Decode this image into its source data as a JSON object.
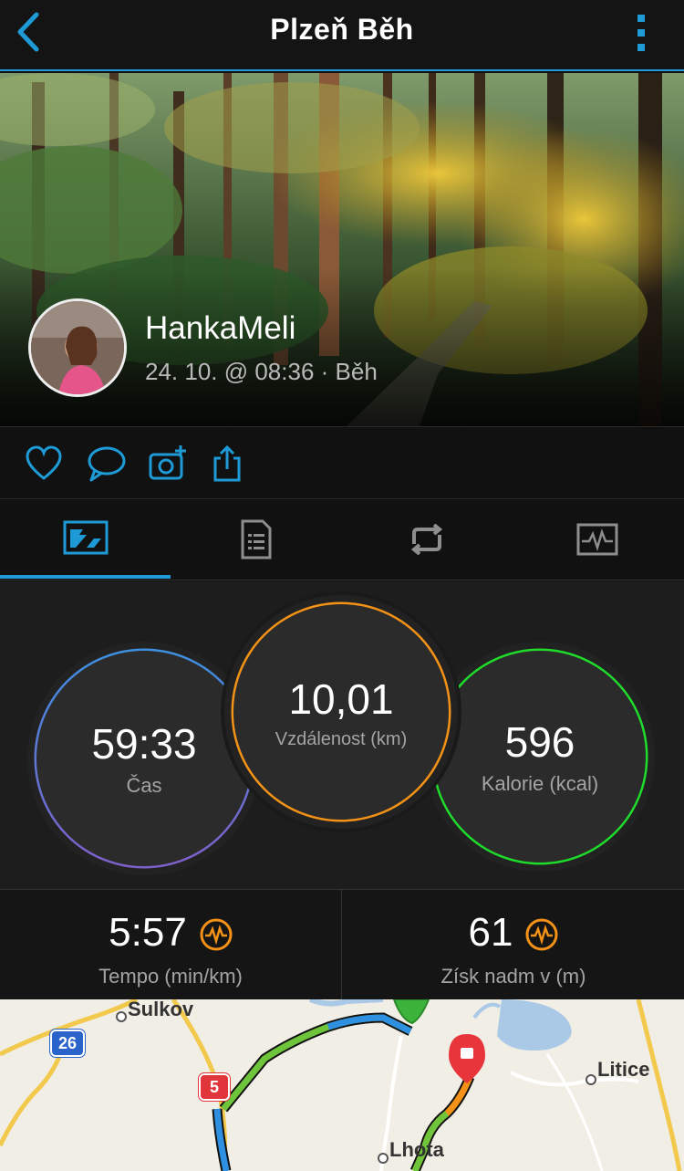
{
  "header": {
    "title": "Plzeň Běh",
    "back_icon": "chevron-left-icon",
    "menu_icon": "more-vertical-icon"
  },
  "profile": {
    "name": "HankaMeli",
    "subtitle": "24. 10. @ 08:36 · Běh"
  },
  "actions": [
    "heart-icon",
    "comment-icon",
    "add-photo-icon",
    "share-icon"
  ],
  "tabs": [
    "overview-icon",
    "details-icon",
    "laps-icon",
    "charts-icon"
  ],
  "stats": {
    "time": {
      "value": "59:33",
      "label": "Čas"
    },
    "distance": {
      "value": "10,01",
      "label": "Vzdálenost (km)"
    },
    "calories": {
      "value": "596",
      "label": "Kalorie (kcal)"
    }
  },
  "metrics": {
    "pace": {
      "value": "5:57",
      "label": "Tempo (min/km)"
    },
    "elevation": {
      "value": "61",
      "label": "Získ nadm v (m)"
    }
  },
  "map": {
    "places": [
      "Sulkov",
      "Litice",
      "Lhota"
    ],
    "roads": [
      "26",
      "5"
    ]
  },
  "colors": {
    "accent": "#1e9bd7",
    "time_ring": "#3d8fe0",
    "distance_ring": "#f39216",
    "calories_ring": "#1fdb2b"
  }
}
